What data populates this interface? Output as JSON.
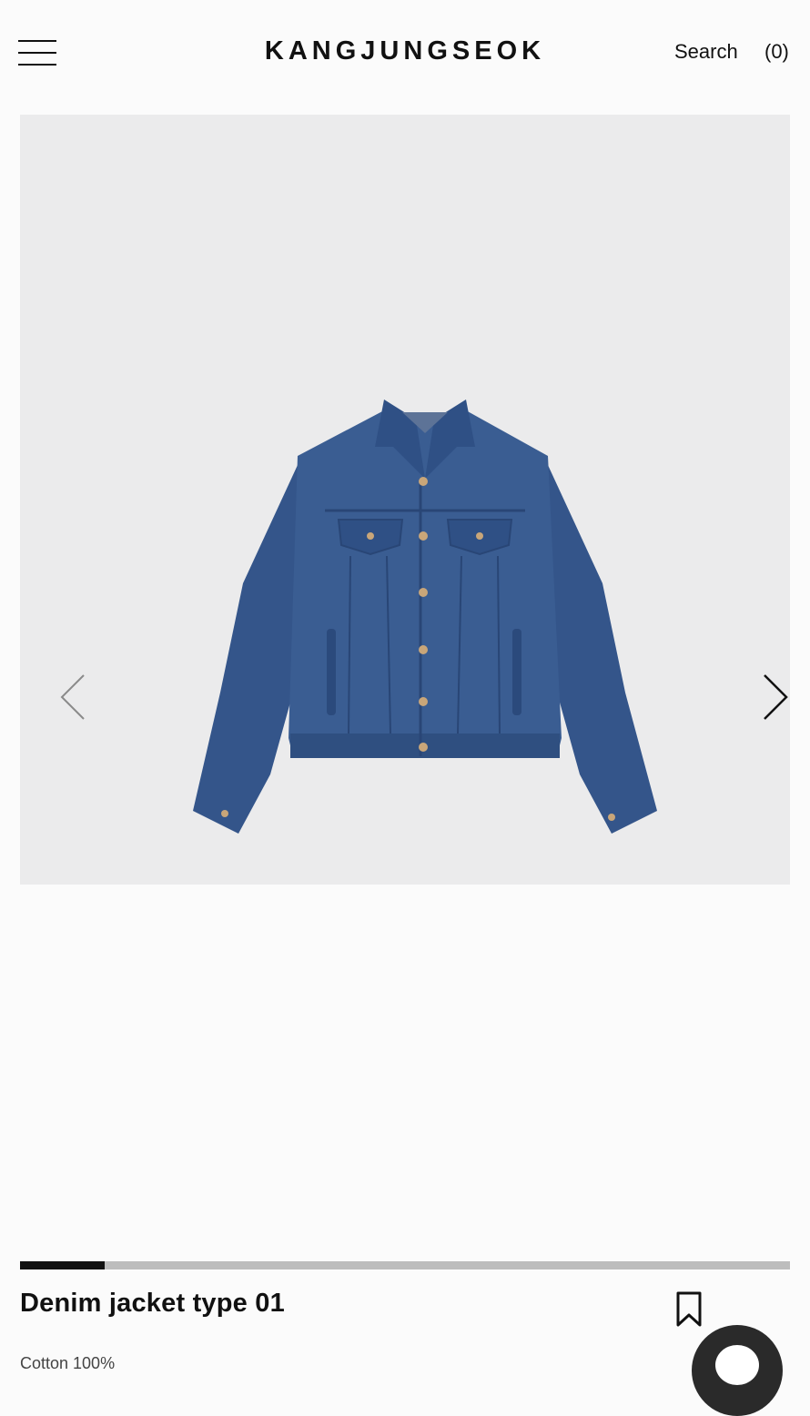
{
  "header": {
    "logo": "KANGJUNGSEOK",
    "search_label": "Search",
    "cart_label": "(0)"
  },
  "gallery": {
    "image_alt": "Denim jacket",
    "current_image": 1,
    "total_images": 9,
    "progress": 0.11
  },
  "product": {
    "title": "Denim jacket type 01",
    "material": "Cotton 100%"
  },
  "icons": [
    "menu-icon",
    "chevron-left-icon",
    "chevron-right-icon",
    "bookmark-icon",
    "chat-icon"
  ],
  "colors": {
    "gallery_bg": "#ebebec",
    "denim": "#34558a",
    "progress_track": "#bdbdbd",
    "progress_fill": "#111111"
  }
}
